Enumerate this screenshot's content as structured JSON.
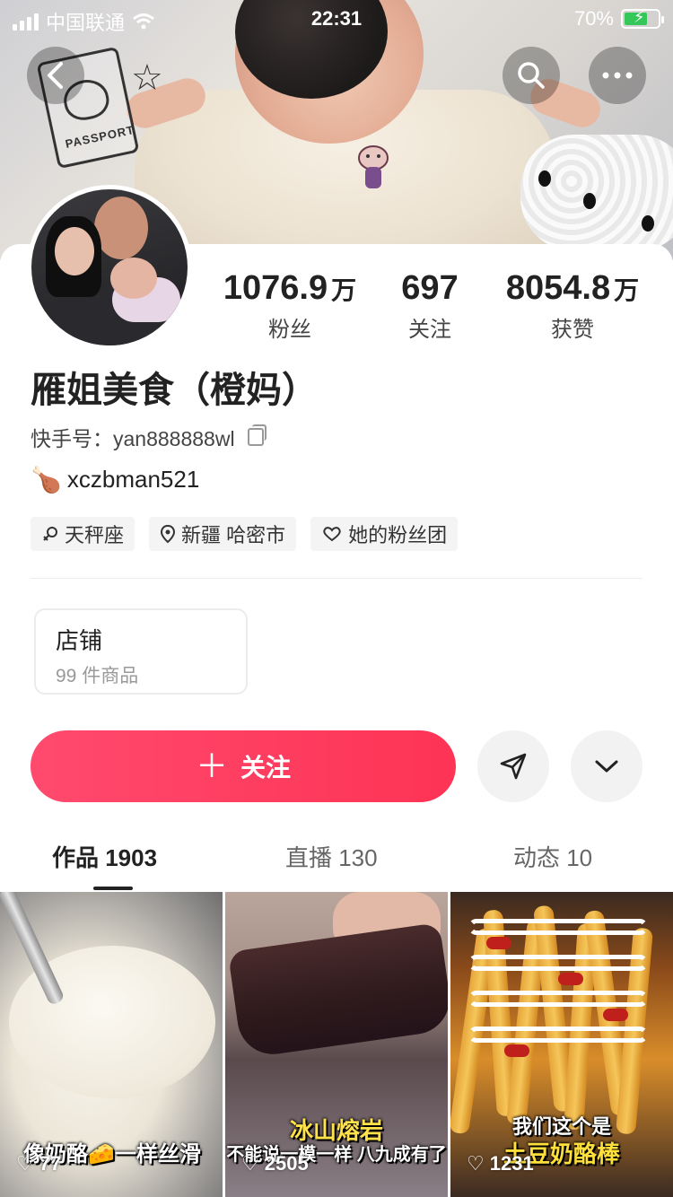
{
  "status_bar": {
    "carrier": "中国联通",
    "time": "22:31",
    "battery": "70%",
    "battery_level": 0.7
  },
  "cover": {
    "passport_text": "PASSPORT"
  },
  "profile": {
    "name": "雁姐美食（橙妈）",
    "kuaishou_id": "快手号：yan888888wl",
    "bio": "xczbman521",
    "stats": [
      {
        "value": "1076.9",
        "unit": "万",
        "label": "粉丝"
      },
      {
        "value": "697",
        "unit": "",
        "label": "关注"
      },
      {
        "value": "8054.8",
        "unit": "万",
        "label": "获赞"
      }
    ],
    "tags": [
      {
        "icon": "libra-icon",
        "text": "天秤座"
      },
      {
        "icon": "location-pin-icon",
        "text": "新疆 哈密市"
      },
      {
        "icon": "heart-outline-icon",
        "text": "她的粉丝团"
      }
    ]
  },
  "shop": {
    "title": "店铺",
    "count": "99 件商品"
  },
  "actions": {
    "follow_label": "关注",
    "follow_icon": "plus-icon",
    "share_icon": "send-icon",
    "expand_icon": "chevron-down-icon"
  },
  "tabs": [
    {
      "label": "作品 1903",
      "active": true
    },
    {
      "label": "直播 130",
      "active": false
    },
    {
      "label": "动态 10",
      "active": false
    }
  ],
  "videos": [
    {
      "caption": "像奶酪🧀一样丝滑",
      "likes": "77"
    },
    {
      "caption_top": "冰山熔岩",
      "caption_bottom": "不能说一模一样 八九成有了",
      "likes": "2505"
    },
    {
      "caption_top": "我们这个是",
      "caption_bottom": "土豆奶酪棒",
      "likes": "1231"
    }
  ],
  "colors": {
    "accent": "#fe3355",
    "battery_green": "#35c759"
  }
}
